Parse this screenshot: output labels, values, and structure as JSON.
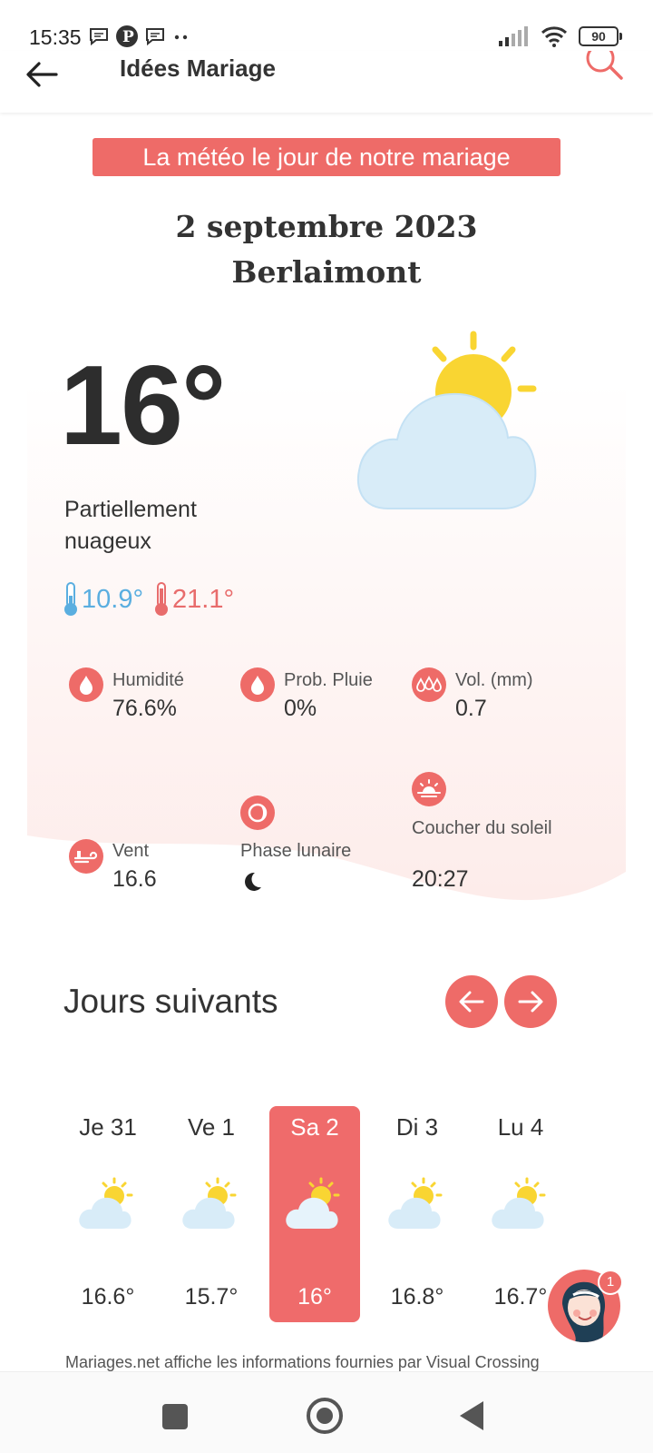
{
  "status_bar": {
    "time": "15:35",
    "battery": "90",
    "icons": [
      "chat-bubble-icon",
      "p-app-icon",
      "chat-bubble-icon",
      "more-dots-icon",
      "signal-icon",
      "wifi-icon",
      "battery-icon"
    ]
  },
  "header": {
    "title": "Idées Mariage",
    "back_icon": "arrow-left-icon",
    "search_icon": "search-icon"
  },
  "banner": "La météo le jour de notre mariage",
  "date": "2 septembre 2023",
  "place": "Berlaimont",
  "current": {
    "temperature": "16°",
    "condition": "Partiellement nuageux",
    "min": "10.9°",
    "max": "21.1°"
  },
  "stats": {
    "humidity": {
      "label": "Humidité",
      "value": "76.6%",
      "icon": "drop-icon"
    },
    "rain_prob": {
      "label": "Prob. Pluie",
      "value": "0%",
      "icon": "drop-icon"
    },
    "volume": {
      "label": "Vol. (mm)",
      "value": "0.7",
      "icon": "raindrops-icon"
    },
    "wind": {
      "label": "Vent",
      "value": "16.6",
      "icon": "wind-icon"
    },
    "moon": {
      "label": "Phase lunaire",
      "icon": "moon-phase-icon"
    },
    "sunset": {
      "label": "Coucher du soleil",
      "value": "20:27",
      "icon": "sunset-icon"
    }
  },
  "next_days": {
    "title": "Jours suivants",
    "days": [
      {
        "name": "Je 31",
        "temp": "16.6°"
      },
      {
        "name": "Ve 1",
        "temp": "15.7°"
      },
      {
        "name": "Sa 2",
        "temp": "16°",
        "active": true
      },
      {
        "name": "Di 3",
        "temp": "16.8°"
      },
      {
        "name": "Lu 4",
        "temp": "16.7°"
      }
    ]
  },
  "chat_badge": "1",
  "footer_note": "Mariages.net affiche les informations fournies par Visual Crossing",
  "colors": {
    "accent": "#ee6b68",
    "sun": "#f9d532",
    "cloud": "#cfe8f6",
    "cold": "#5aaee0",
    "hot": "#e86c6c"
  }
}
